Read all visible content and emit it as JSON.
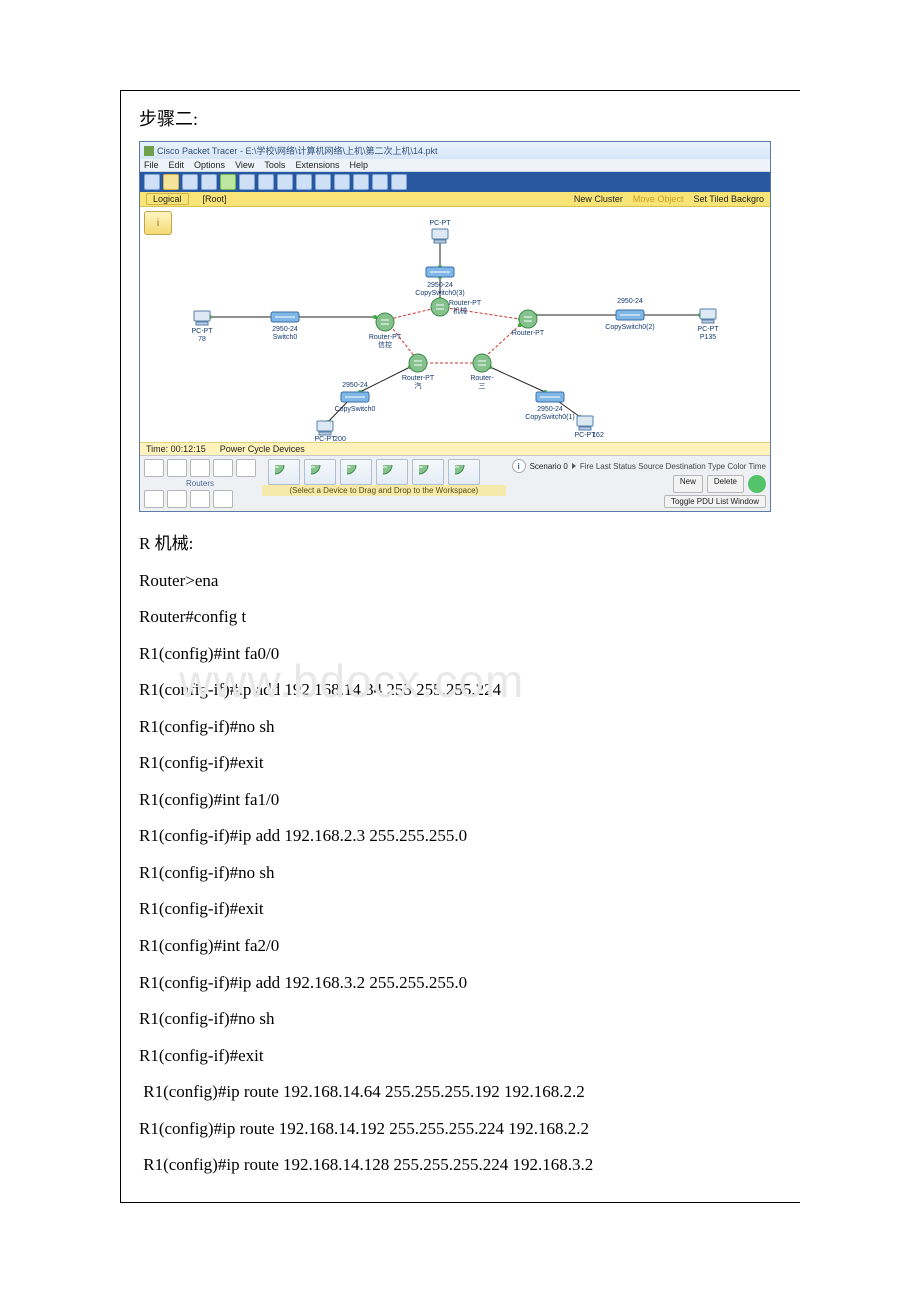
{
  "doc": {
    "step_title": "步骤二:",
    "router_section_label": "R 机械:",
    "watermark_text": "www.bdocx.com"
  },
  "packet_tracer": {
    "window_title": "Cisco Packet Tracer - E:\\学校\\网络\\计算机网络\\上机\\第二次上机\\14.pkt",
    "menu": [
      "File",
      "Edit",
      "Options",
      "View",
      "Tools",
      "Extensions",
      "Help"
    ],
    "sidebar_tab": "Logical",
    "root_label": "[Root]",
    "topbar_right": [
      "New Cluster",
      "Move Object",
      "Set Tiled Backgro"
    ],
    "badge_text": "i",
    "time_label": "Time: 00:12:15",
    "power_label": "Power Cycle Devices",
    "palette_label": "Routers",
    "hint_label": "(Select a Device to Drag and Drop to the Workspace)",
    "scenario_label": "Scenario 0",
    "status_cols": "Fire   Last Status   Source   Destination   Type   Color   Time",
    "buttons": {
      "new": "New",
      "delete": "Delete",
      "toggle": "Toggle PDU List Window"
    },
    "devices": {
      "pc_top": "PC-PT",
      "sw_top": {
        "l1": "2950-24",
        "l2": "CopySwitch0(3)"
      },
      "r_top": {
        "l1": "Router-PT",
        "l2": "机械"
      },
      "pc_left": {
        "l1": "PC-PT",
        "l2": "78"
      },
      "sw_left": {
        "l1": "2950-24",
        "l2": "Switch0"
      },
      "r_left": {
        "l1": "Router-PT",
        "l2": "信控"
      },
      "r_right": "Router-PT",
      "sw_right": {
        "l1": "2950-24",
        "l2": "CopySwitch0(2)"
      },
      "pc_right": {
        "l1": "PC-PT",
        "l2": "P135"
      },
      "r_bl": {
        "l1": "Router-PT",
        "l2": "汽"
      },
      "r_br": {
        "l1": "Router-",
        "l2": "三"
      },
      "sw_bl": {
        "l1": "2950-24",
        "l2": "CopySwitch0"
      },
      "pc_bl": {
        "l1": "PC-PT",
        "l2": "200"
      },
      "sw_br": {
        "l1": "2950-24",
        "l2": "CopySwitch0(1)"
      },
      "pc_br": {
        "l1": "PC-PT",
        "l2": "162"
      }
    }
  },
  "config": {
    "lines": [
      "Router>ena",
      "Router#config t",
      "R1(config)#int fa0/0",
      "R1(config-if)#ip add 192.168.14.34 255.255.255.224",
      "R1(config-if)#no sh",
      "R1(config-if)#exit",
      "R1(config)#int fa1/0",
      "R1(config-if)#ip add 192.168.2.3 255.255.255.0",
      "R1(config-if)#no sh",
      "R1(config-if)#exit",
      "R1(config)#int fa2/0",
      "R1(config-if)#ip add 192.168.3.2 255.255.255.0",
      "R1(config-if)#no sh",
      "R1(config-if)#exit",
      " R1(config)#ip route 192.168.14.64 255.255.255.192 192.168.2.2",
      "R1(config)#ip route 192.168.14.192 255.255.255.224 192.168.2.2",
      " R1(config)#ip route 192.168.14.128 255.255.255.224 192.168.3.2"
    ]
  }
}
